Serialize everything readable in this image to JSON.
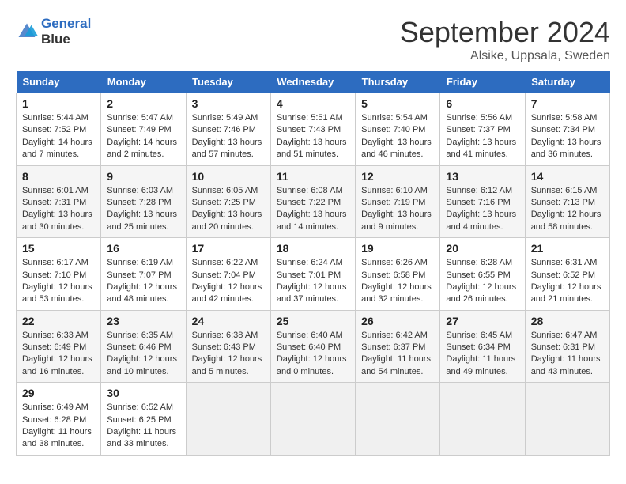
{
  "logo": {
    "line1": "General",
    "line2": "Blue"
  },
  "title": "September 2024",
  "location": "Alsike, Uppsala, Sweden",
  "days_of_week": [
    "Sunday",
    "Monday",
    "Tuesday",
    "Wednesday",
    "Thursday",
    "Friday",
    "Saturday"
  ],
  "weeks": [
    [
      {
        "day": 1,
        "sunrise": "5:44 AM",
        "sunset": "7:52 PM",
        "daylight": "14 hours and 7 minutes."
      },
      {
        "day": 2,
        "sunrise": "5:47 AM",
        "sunset": "7:49 PM",
        "daylight": "14 hours and 2 minutes."
      },
      {
        "day": 3,
        "sunrise": "5:49 AM",
        "sunset": "7:46 PM",
        "daylight": "13 hours and 57 minutes."
      },
      {
        "day": 4,
        "sunrise": "5:51 AM",
        "sunset": "7:43 PM",
        "daylight": "13 hours and 51 minutes."
      },
      {
        "day": 5,
        "sunrise": "5:54 AM",
        "sunset": "7:40 PM",
        "daylight": "13 hours and 46 minutes."
      },
      {
        "day": 6,
        "sunrise": "5:56 AM",
        "sunset": "7:37 PM",
        "daylight": "13 hours and 41 minutes."
      },
      {
        "day": 7,
        "sunrise": "5:58 AM",
        "sunset": "7:34 PM",
        "daylight": "13 hours and 36 minutes."
      }
    ],
    [
      {
        "day": 8,
        "sunrise": "6:01 AM",
        "sunset": "7:31 PM",
        "daylight": "13 hours and 30 minutes."
      },
      {
        "day": 9,
        "sunrise": "6:03 AM",
        "sunset": "7:28 PM",
        "daylight": "13 hours and 25 minutes."
      },
      {
        "day": 10,
        "sunrise": "6:05 AM",
        "sunset": "7:25 PM",
        "daylight": "13 hours and 20 minutes."
      },
      {
        "day": 11,
        "sunrise": "6:08 AM",
        "sunset": "7:22 PM",
        "daylight": "13 hours and 14 minutes."
      },
      {
        "day": 12,
        "sunrise": "6:10 AM",
        "sunset": "7:19 PM",
        "daylight": "13 hours and 9 minutes."
      },
      {
        "day": 13,
        "sunrise": "6:12 AM",
        "sunset": "7:16 PM",
        "daylight": "13 hours and 4 minutes."
      },
      {
        "day": 14,
        "sunrise": "6:15 AM",
        "sunset": "7:13 PM",
        "daylight": "12 hours and 58 minutes."
      }
    ],
    [
      {
        "day": 15,
        "sunrise": "6:17 AM",
        "sunset": "7:10 PM",
        "daylight": "12 hours and 53 minutes."
      },
      {
        "day": 16,
        "sunrise": "6:19 AM",
        "sunset": "7:07 PM",
        "daylight": "12 hours and 48 minutes."
      },
      {
        "day": 17,
        "sunrise": "6:22 AM",
        "sunset": "7:04 PM",
        "daylight": "12 hours and 42 minutes."
      },
      {
        "day": 18,
        "sunrise": "6:24 AM",
        "sunset": "7:01 PM",
        "daylight": "12 hours and 37 minutes."
      },
      {
        "day": 19,
        "sunrise": "6:26 AM",
        "sunset": "6:58 PM",
        "daylight": "12 hours and 32 minutes."
      },
      {
        "day": 20,
        "sunrise": "6:28 AM",
        "sunset": "6:55 PM",
        "daylight": "12 hours and 26 minutes."
      },
      {
        "day": 21,
        "sunrise": "6:31 AM",
        "sunset": "6:52 PM",
        "daylight": "12 hours and 21 minutes."
      }
    ],
    [
      {
        "day": 22,
        "sunrise": "6:33 AM",
        "sunset": "6:49 PM",
        "daylight": "12 hours and 16 minutes."
      },
      {
        "day": 23,
        "sunrise": "6:35 AM",
        "sunset": "6:46 PM",
        "daylight": "12 hours and 10 minutes."
      },
      {
        "day": 24,
        "sunrise": "6:38 AM",
        "sunset": "6:43 PM",
        "daylight": "12 hours and 5 minutes."
      },
      {
        "day": 25,
        "sunrise": "6:40 AM",
        "sunset": "6:40 PM",
        "daylight": "12 hours and 0 minutes."
      },
      {
        "day": 26,
        "sunrise": "6:42 AM",
        "sunset": "6:37 PM",
        "daylight": "11 hours and 54 minutes."
      },
      {
        "day": 27,
        "sunrise": "6:45 AM",
        "sunset": "6:34 PM",
        "daylight": "11 hours and 49 minutes."
      },
      {
        "day": 28,
        "sunrise": "6:47 AM",
        "sunset": "6:31 PM",
        "daylight": "11 hours and 43 minutes."
      }
    ],
    [
      {
        "day": 29,
        "sunrise": "6:49 AM",
        "sunset": "6:28 PM",
        "daylight": "11 hours and 38 minutes."
      },
      {
        "day": 30,
        "sunrise": "6:52 AM",
        "sunset": "6:25 PM",
        "daylight": "11 hours and 33 minutes."
      },
      null,
      null,
      null,
      null,
      null
    ]
  ]
}
